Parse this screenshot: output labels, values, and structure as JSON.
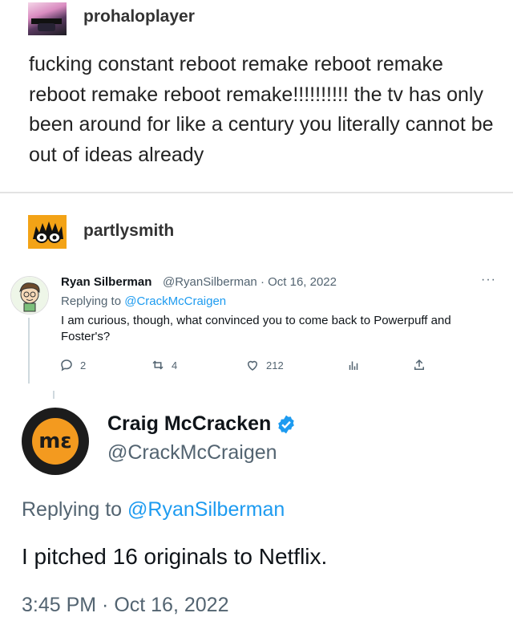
{
  "post1": {
    "username": "prohaloplayer",
    "text": "fucking constant reboot remake reboot remake reboot remake reboot remake!!!!!!!!!! the tv has only been around for like a century you literally cannot be out of ideas already"
  },
  "post2": {
    "username": "partlysmith"
  },
  "reply_tweet": {
    "name": "Ryan Silberman",
    "handle_date": "@RyanSilberman · Oct 16, 2022",
    "more": "···",
    "replying_prefix": "Replying to ",
    "replying_to": "@CrackMcCraigen",
    "text": "I am curious, though, what convinced you to come back to Powerpuff and Foster's?",
    "reply_count": "2",
    "retweet_count": "4",
    "like_count": "212"
  },
  "main_tweet": {
    "avatar_text": "mε",
    "name": "Craig McCracken",
    "handle": "@CrackMcCraigen",
    "replying_prefix": "Replying to ",
    "replying_to": "@RyanSilberman",
    "text": "I pitched 16 originals to Netflix.",
    "timestamp": "3:45 PM · Oct 16, 2022"
  },
  "colors": {
    "twitter_blue": "#1d9bf0",
    "muted": "#536471",
    "verified": "#1d9bf0"
  }
}
